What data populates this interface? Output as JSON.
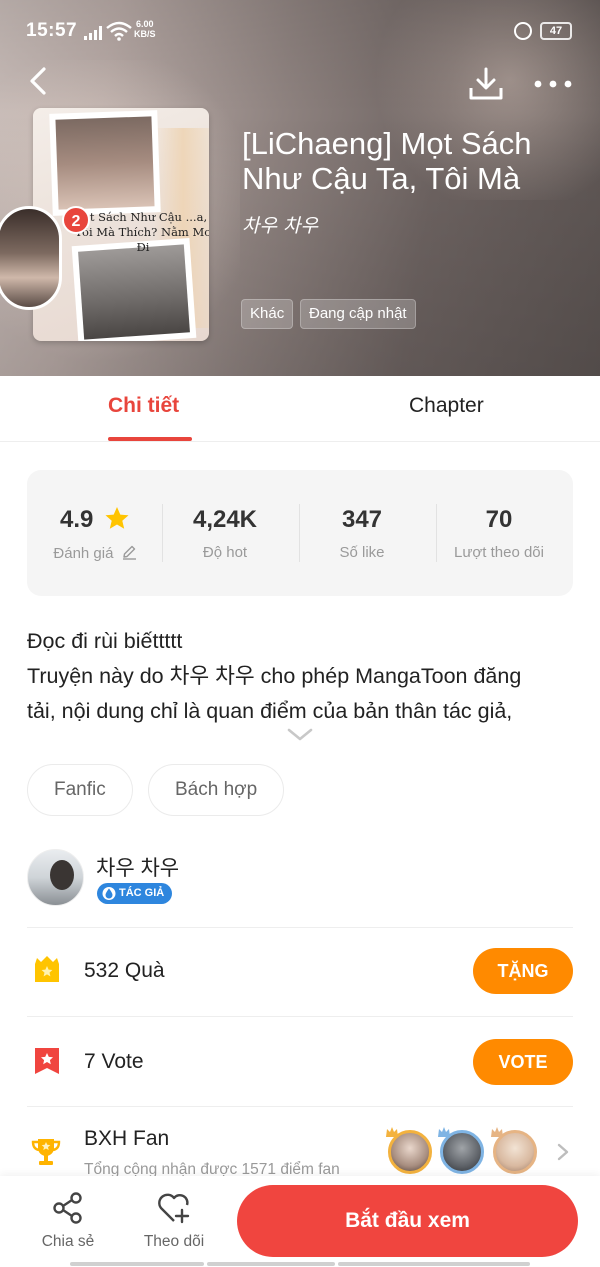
{
  "status_bar": {
    "time": "15:57",
    "net_speed_value": "6.00",
    "net_speed_unit": "KB/S",
    "battery": "47"
  },
  "book": {
    "title": "[LiChaeng] Mọt Sách Như Cậu Ta, Tôi Mà",
    "author": "차우 차우",
    "cover_text": "...t Sách Như Cậu ...a, Tôi Mà Thích? Nằm Mơ Đi",
    "badge": "2",
    "genres": [
      "Khác",
      "Đang cập nhật"
    ]
  },
  "tabs": {
    "detail": "Chi tiết",
    "chapter": "Chapter"
  },
  "stats": {
    "rating": {
      "value": "4.9",
      "label": "Đánh giá"
    },
    "hot": {
      "value": "4,24K",
      "label": "Độ hot"
    },
    "likes": {
      "value": "347",
      "label": "Số like"
    },
    "followers": {
      "value": "70",
      "label": "Lượt theo dõi"
    }
  },
  "description": {
    "line1": "Đọc đi rùi biếttttt",
    "line2": "Truyện này do 차우 차우 cho phép MangaToon đăng",
    "line3": "tải, nội dung chỉ là quan điểm của bản thân tác giả,"
  },
  "tags": [
    "Fanfic",
    "Bách hợp"
  ],
  "author": {
    "name": "차우 차우",
    "role": "TÁC GIẢ"
  },
  "gifts": {
    "count": "532",
    "label": "Quà",
    "button": "TẶNG"
  },
  "votes": {
    "count": "7",
    "label": "Vote",
    "button": "VOTE"
  },
  "fan_rank": {
    "title": "BXH Fan",
    "subtitle": "Tổng cộng nhận được 1571 điểm fan"
  },
  "bottom_bar": {
    "share": "Chia sẻ",
    "follow": "Theo dõi",
    "start": "Bắt đầu xem"
  },
  "colors": {
    "accent_red": "#f0453f",
    "tab_red": "#e8453c",
    "button_orange": "#ff8a00",
    "star_yellow": "#ffc400",
    "author_badge_blue": "#2e86de"
  },
  "icons": [
    "back-arrow-icon",
    "download-icon",
    "more-dots-icon",
    "star-icon",
    "pencil-icon",
    "chevron-down-icon",
    "gift-icon",
    "vote-ticket-icon",
    "trophy-icon",
    "chevron-right-icon",
    "share-icon",
    "heart-plus-icon",
    "drop-icon"
  ]
}
